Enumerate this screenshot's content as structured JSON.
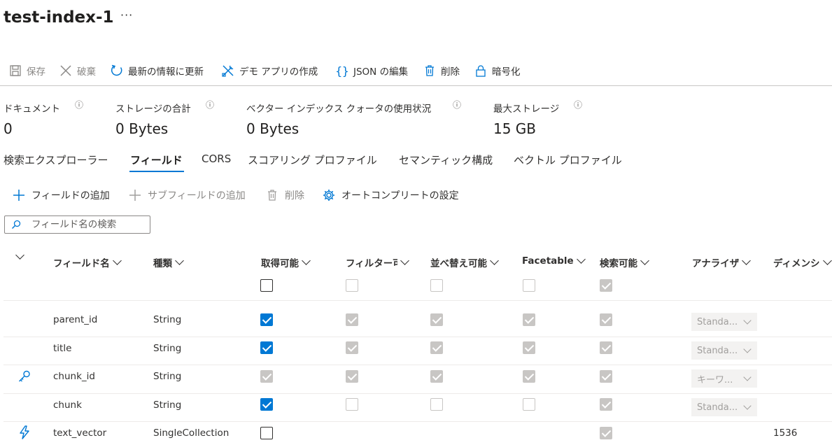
{
  "header": {
    "title": "test-index-1",
    "more": "···"
  },
  "toolbar": {
    "save": "保存",
    "discard": "破棄",
    "refresh": "最新の情報に更新",
    "demo_app": "デモ アプリの作成",
    "edit_json": "JSON の編集",
    "delete": "削除",
    "encryption": "暗号化"
  },
  "stats": [
    {
      "label": "ドキュメント",
      "value": "0"
    },
    {
      "label": "ストレージの合計",
      "value": "0 Bytes"
    },
    {
      "label": "ベクター インデックス クォータの使用状況",
      "value": "0 Bytes"
    },
    {
      "label": "最大ストレージ",
      "value": "15 GB"
    }
  ],
  "info_icon": "ⓘ",
  "tabs": [
    "検索エクスプローラー",
    "フィールド",
    "CORS",
    "スコアリング プロファイル",
    "セマンティック構成",
    "ベクトル プロファイル"
  ],
  "active_tab": "フィールド",
  "actions": {
    "add_field": "フィールドの追加",
    "add_subfield": "サブフィールドの追加",
    "delete": "削除",
    "autocomplete": "オートコンプリートの設定"
  },
  "search": {
    "placeholder": "フィールド名の検索"
  },
  "columns": {
    "name": "フィールド名",
    "type": "種類",
    "retrievable": "取得可能",
    "filterable": "フィルター可",
    "sortable": "並べ替え可能",
    "facetable": "Facetable",
    "searchable": "検索可能",
    "analyzer": "アナライザ",
    "dimensions": "ディメンシ"
  },
  "accent_color": "#0078d4",
  "rows": [
    {
      "icon": "",
      "name": "parent_id",
      "type": "String",
      "analyzer": "Standa...",
      "dimensions": ""
    },
    {
      "icon": "",
      "name": "title",
      "type": "String",
      "analyzer": "Standa...",
      "dimensions": ""
    },
    {
      "icon": "key-icon",
      "name": "chunk_id",
      "type": "String",
      "analyzer": "キーワ...",
      "dimensions": ""
    },
    {
      "icon": "",
      "name": "chunk",
      "type": "String",
      "analyzer": "Standa...",
      "dimensions": ""
    },
    {
      "icon": "lightning-icon",
      "name": "text_vector",
      "type": "SingleCollection",
      "analyzer": "",
      "dimensions": "1536"
    }
  ]
}
